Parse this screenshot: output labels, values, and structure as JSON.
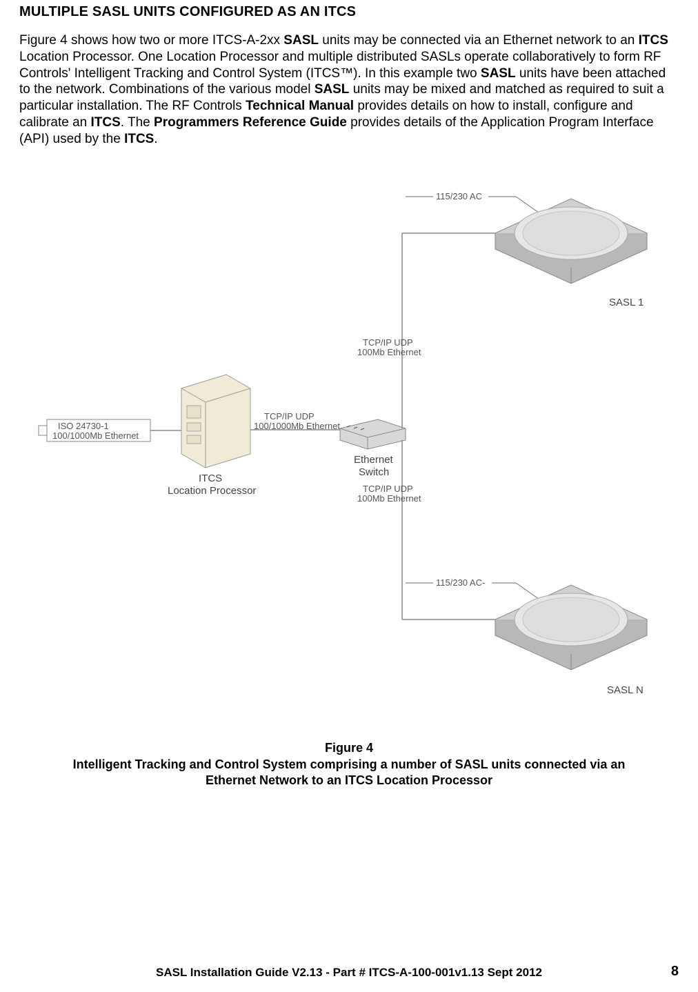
{
  "heading": "MULTIPLE SASL UNITS CONFIGURED AS AN ITCS",
  "p": {
    "a1": "Figure 4 shows how two or more ITCS-A-2xx ",
    "a2": "SASL",
    "a3": " units may be connected via an Ethernet network to an ",
    "a4": "ITCS",
    "a5": " Location Processor.  One Location Processor and multiple distributed SASLs operate collaboratively to form RF Controls' Intelligent Tracking and Control System (ITCS™). In this example two ",
    "a6": "SASL",
    "a7": " units have been attached to the network. Combinations of the various model ",
    "a8": "SASL",
    "a9": " units may be mixed and matched as required to suit a particular installation. The RF Controls ",
    "a10": "Technical Manual",
    "a11": " provides details on how to install, configure and calibrate an ",
    "a12": "ITCS",
    "a13": ". The ",
    "a14": "Programmers Reference Guide",
    "a15": " provides details of the Application Program Interface (API) used by the ",
    "a16": "ITCS",
    "a17": "."
  },
  "diagram": {
    "iso_left_l1": "ISO 24730-1",
    "iso_left_l2": "100/1000Mb Ethernet",
    "itcs_lp_l1": "ITCS",
    "itcs_lp_l2": "Location Processor",
    "tcp_lp_l1": "TCP/IP UDP",
    "tcp_lp_l2": "100/1000Mb Ethernet",
    "ethernet_switch_l1": "Ethernet",
    "ethernet_switch_l2": "Switch",
    "tcp_top_l1": "TCP/IP UDP",
    "tcp_top_l2": "100Mb Ethernet",
    "tcp_bot_l1": "TCP/IP UDP",
    "tcp_bot_l2": "100Mb Ethernet",
    "ac_top": "115/230 AC",
    "ac_bot": "115/230 AC-",
    "sasl1": "SASL 1",
    "sasln": "SASL N"
  },
  "caption": {
    "l1": "Figure 4",
    "l2": "Intelligent Tracking and Control System comprising a number of SASL units connected via an",
    "l3": "Ethernet Network to an ITCS Location Processor"
  },
  "footer": {
    "text": "SASL Installation Guide V2.13 - Part # ITCS-A-100-001v1.13 Sept 2012",
    "page": "8"
  }
}
